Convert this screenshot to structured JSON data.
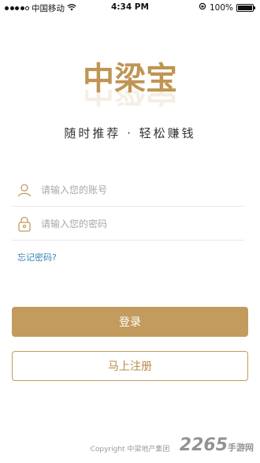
{
  "status_bar": {
    "carrier": "中国移动",
    "time": "4:34 PM",
    "battery": "100%",
    "signal_bars": 4,
    "battery_fraction": 1.0
  },
  "logo": {
    "text": "中梁宝"
  },
  "slogan": "随时推荐 · 轻松赚钱",
  "form": {
    "account_placeholder": "请输入您的账号",
    "password_placeholder": "请输入您的密码",
    "account_icon": "user-icon",
    "password_icon": "lock-icon",
    "forgot_label": "忘记密码?"
  },
  "buttons": {
    "login_label": "登录",
    "register_label": "马上注册"
  },
  "footer": {
    "copyright": "Copyright 中梁地产集团"
  },
  "watermark": {
    "number": "2265",
    "site": "手游网"
  },
  "colors": {
    "gold": "#c29b5d",
    "link": "#3a86b6"
  }
}
